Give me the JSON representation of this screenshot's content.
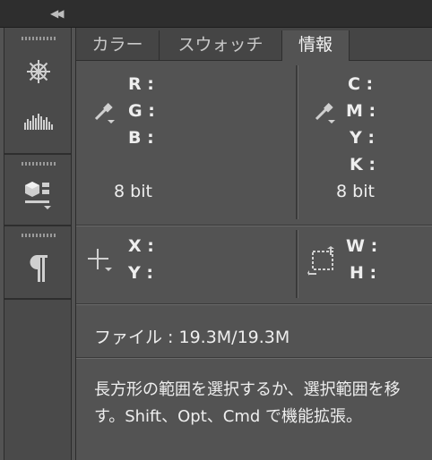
{
  "tabs": [
    {
      "label": "カラー",
      "active": false
    },
    {
      "label": "スウォッチ",
      "active": false
    },
    {
      "label": "情報",
      "active": true
    }
  ],
  "rgb": {
    "r": "R :",
    "g": "G :",
    "b": "B :",
    "bits": "8 bit"
  },
  "cmyk": {
    "c": "C :",
    "m": "M :",
    "y": "Y :",
    "k": "K :",
    "bits": "8 bit"
  },
  "xy": {
    "x": "X :",
    "y": "Y :"
  },
  "wh": {
    "w": "W :",
    "h": "H :"
  },
  "file_info": "ファイル : 19.3M/19.3M",
  "hint_line1": "長方形の範囲を選択するか、選択範囲を移",
  "hint_line2": "す。Shift、Opt、Cmd で機能拡張。",
  "tool_icons": [
    "navigator-icon",
    "histogram-icon",
    "3d-icon",
    "paragraph-icon",
    "eyedropper-icon",
    "crosshair-icon",
    "marquee-size-icon"
  ]
}
